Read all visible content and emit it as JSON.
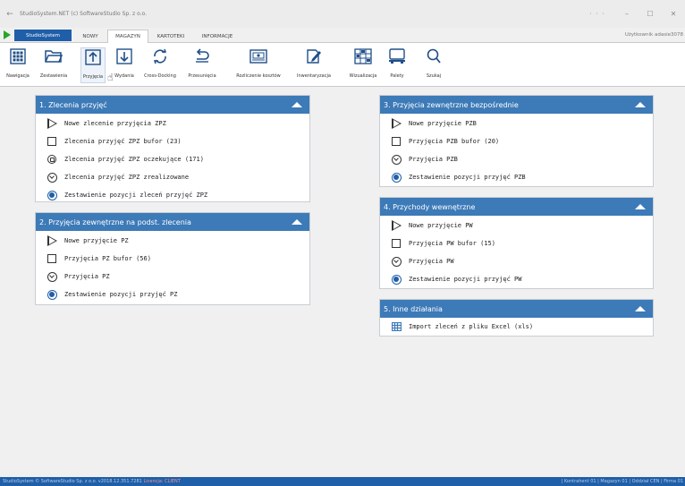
{
  "window": {
    "title": "StudioSystem.NET (c) SoftwareStudio Sp. z o.o.",
    "back_icon": "arrow-left-icon",
    "more_label": "· · ·",
    "minimize_label": "–",
    "maximize_label": "☐",
    "close_label": "✕"
  },
  "tabs": {
    "app_button": "StudioSystem",
    "items": [
      "NOWY",
      "MAGAZYN",
      "KARTOTEKI",
      "INFORMACJE"
    ],
    "active": "MAGAZYN",
    "user": "Użytkownik adasie3078"
  },
  "toolbar": {
    "items": [
      {
        "label": "Nawigacja",
        "icon": "grid-navigation-icon"
      },
      {
        "label": "Zestawienia",
        "icon": "folder-icon"
      },
      {
        "label": "Przyjęcia",
        "icon": "upload-arrow-icon"
      },
      {
        "label": "Wydania",
        "icon": "download-arrow-icon"
      },
      {
        "label": "Cross-Docking",
        "icon": "refresh-icon"
      },
      {
        "label": "Przesunięcia",
        "icon": "return-arrow-icon"
      },
      {
        "label": "Rozliczenie kosztów",
        "icon": "money-icon"
      },
      {
        "label": "Inwentaryzacja",
        "icon": "edit-document-icon"
      },
      {
        "label": "Wizualizacja",
        "icon": "warehouse-icon"
      },
      {
        "label": "Palety",
        "icon": "pallet-icon"
      },
      {
        "label": "Szukaj",
        "icon": "search-icon"
      }
    ],
    "selected": "Przyjęcia"
  },
  "panels": {
    "p1": {
      "title": "1. Zlecenia przyjęć",
      "items": [
        {
          "label": "Nowe zlecenie przyjęcia ZPZ",
          "icon": "play-outline-icon"
        },
        {
          "label": "Zlecenia przyjęć ZPZ bufor (23)",
          "icon": "square-outline-icon"
        },
        {
          "label": "Zlecenia przyjęć ZPZ oczekujące (171)",
          "icon": "circle-square-icon"
        },
        {
          "label": "Zlecenia przyjęć ZPZ zrealizowane",
          "icon": "circle-chevron-icon"
        },
        {
          "label": "Zestawienie pozycji zleceń przyjęć ZPZ",
          "icon": "radio-filled-icon"
        }
      ]
    },
    "p2": {
      "title": "2. Przyjęcia zewnętrzne na podst. zlecenia",
      "items": [
        {
          "label": "Nowe przyjęcie PZ",
          "icon": "play-outline-icon"
        },
        {
          "label": "Przyjęcia PZ bufor (56)",
          "icon": "square-outline-icon"
        },
        {
          "label": "Przyjęcia PZ",
          "icon": "circle-chevron-icon"
        },
        {
          "label": "Zestawienie pozycji przyjęć PZ",
          "icon": "radio-filled-icon"
        }
      ]
    },
    "p3": {
      "title": "3. Przyjęcia zewnętrzne bezpośrednie",
      "items": [
        {
          "label": "Nowe przyjęcie PZB",
          "icon": "play-outline-icon"
        },
        {
          "label": "Przyjęcia PZB bufor (20)",
          "icon": "square-outline-icon"
        },
        {
          "label": "Przyjęcia PZB",
          "icon": "circle-chevron-icon"
        },
        {
          "label": "Zestawienie pozycji przyjęć PZB",
          "icon": "radio-filled-icon"
        }
      ]
    },
    "p4": {
      "title": "4. Przychody wewnętrzne",
      "items": [
        {
          "label": "Nowe przyjęcie PW",
          "icon": "play-outline-icon"
        },
        {
          "label": "Przyjęcia PW bufor (15)",
          "icon": "square-outline-icon"
        },
        {
          "label": "Przyjęcia PW",
          "icon": "circle-chevron-icon"
        },
        {
          "label": "Zestawienie pozycji przyjęć PW",
          "icon": "radio-filled-icon"
        }
      ]
    },
    "p5": {
      "title": "5. Inne działania",
      "items": [
        {
          "label": "Import zleceń z pliku Excel (xls)",
          "icon": "excel-grid-icon"
        }
      ]
    }
  },
  "status": {
    "left": "StudioSystem © SoftwareStudio Sp. z o.o.   v2018.12.351.7281",
    "license": "Licencja: CLIENT",
    "right": "| Kontrahent 01 | Magazyn 01 | Oddział CEN | Firma 01"
  },
  "colors": {
    "accent": "#1f5ea8",
    "panel_header": "#3d7ab8",
    "start_green": "#2aa52a"
  }
}
